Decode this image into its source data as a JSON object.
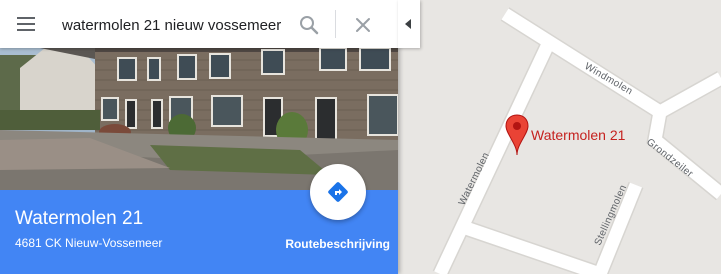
{
  "search": {
    "value": "watermolen 21 nieuw vossemeer",
    "menu_icon": "hamburger-menu-icon",
    "search_icon": "magnifier-icon",
    "close_icon": "close-x-icon"
  },
  "panel": {
    "place_name": "Watermolen 21",
    "address": "4681 CK Nieuw-Vossemeer",
    "route_label": "Routebeschrijving",
    "directions_icon": "directions-diamond-icon",
    "collapse_icon": "caret-left-icon",
    "accent_color": "#4285f4"
  },
  "map": {
    "pin_label": "Watermolen 21",
    "pin_color": "#ea4335",
    "streets": {
      "windmolen": "Windmolen",
      "watermolen": "Watermolen",
      "grondzeiler": "Grondzeiler",
      "stellingmolen": "Stellingmolen"
    }
  }
}
